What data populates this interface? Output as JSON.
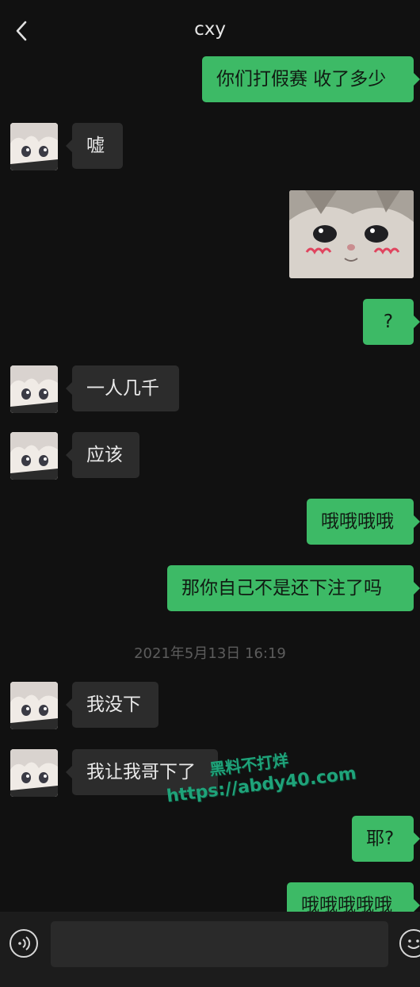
{
  "header": {
    "title": "cxy"
  },
  "messages": {
    "m1": "你们打假赛 收了多少",
    "m2": "嘘",
    "m4": "?",
    "m5": "一人几千",
    "m6": "应该",
    "m7": "哦哦哦哦",
    "m8": "那你自己不是还下注了吗",
    "m9": "我没下",
    "m10": "我让我哥下了",
    "m11": "耶?",
    "m12": "哦哦哦哦哦"
  },
  "timestamp": "2021年5月13日 16:19",
  "watermark": {
    "line1": "黑料不打烊",
    "line2": "https://abdy40.com"
  },
  "colors": {
    "background": "#111111",
    "outgoing_bubble": "#3dba66",
    "incoming_bubble": "#2c2c2c"
  },
  "icons": {
    "back": "chevron-left-icon",
    "voice": "voice-icon",
    "emoji": "emoji-icon"
  }
}
